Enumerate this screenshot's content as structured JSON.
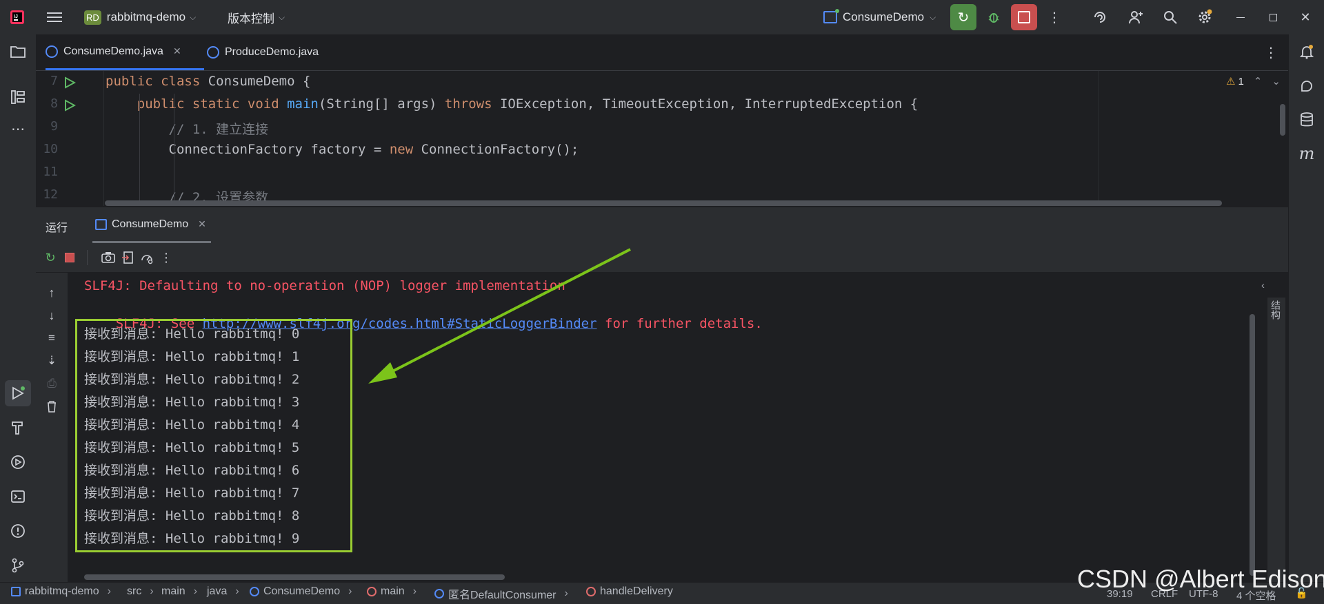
{
  "titlebar": {
    "project_badge": "RD",
    "project_name": "rabbitmq-demo",
    "vcs_menu": "版本控制",
    "run_config": "ConsumeDemo"
  },
  "tabs": [
    {
      "label": "ConsumeDemo.java",
      "active": true
    },
    {
      "label": "ProduceDemo.java",
      "active": false
    }
  ],
  "editor": {
    "warning_count": "1",
    "lines": [
      {
        "num": "7",
        "parts": [
          [
            "kw",
            "public class "
          ],
          [
            "",
            "ConsumeDemo {"
          ]
        ]
      },
      {
        "num": "8",
        "parts": [
          [
            "",
            "    "
          ],
          [
            "kw",
            "public static void "
          ],
          [
            "fn",
            "main"
          ],
          [
            "",
            "(String[] args) "
          ],
          [
            "kw",
            "throws "
          ],
          [
            "",
            "IOException, TimeoutException, InterruptedException {"
          ]
        ]
      },
      {
        "num": "9",
        "parts": [
          [
            "cm",
            "        // 1. 建立连接"
          ]
        ]
      },
      {
        "num": "10",
        "parts": [
          [
            "",
            "        ConnectionFactory factory = "
          ],
          [
            "kw",
            "new "
          ],
          [
            "",
            "ConnectionFactory();"
          ]
        ]
      },
      {
        "num": "11",
        "parts": [
          [
            "",
            ""
          ]
        ]
      },
      {
        "num": "12",
        "parts": [
          [
            "cm",
            "        // 2. 设置参数"
          ]
        ]
      }
    ]
  },
  "run_panel": {
    "title": "运行",
    "tab_label": "ConsumeDemo",
    "side_label": "结构"
  },
  "console": {
    "slf4j_line1": "SLF4J: Defaulting to no-operation (NOP) logger implementation",
    "slf4j_line2_prefix": "SLF4J: See ",
    "slf4j_link": "http://www.slf4j.org/codes.html#StaticLoggerBinder",
    "slf4j_line2_suffix": " for further details.",
    "messages": [
      "接收到消息: Hello rabbitmq! 0",
      "接收到消息: Hello rabbitmq! 1",
      "接收到消息: Hello rabbitmq! 2",
      "接收到消息: Hello rabbitmq! 3",
      "接收到消息: Hello rabbitmq! 4",
      "接收到消息: Hello rabbitmq! 5",
      "接收到消息: Hello rabbitmq! 6",
      "接收到消息: Hello rabbitmq! 7",
      "接收到消息: Hello rabbitmq! 8",
      "接收到消息: Hello rabbitmq! 9"
    ]
  },
  "statusbar": {
    "crumbs": [
      "rabbitmq-demo",
      "src",
      "main",
      "java",
      "ConsumeDemo",
      "main",
      "匿名DefaultConsumer",
      "handleDelivery"
    ],
    "position": "39:19",
    "line_sep": "CRLF",
    "encoding": "UTF-8",
    "indent": "4 个空格"
  },
  "watermark": "CSDN @Albert Edison",
  "colors": {
    "highlight_box": "#9acd32",
    "arrow": "#7cc41a",
    "error_text": "#f75464",
    "link": "#548af7"
  }
}
